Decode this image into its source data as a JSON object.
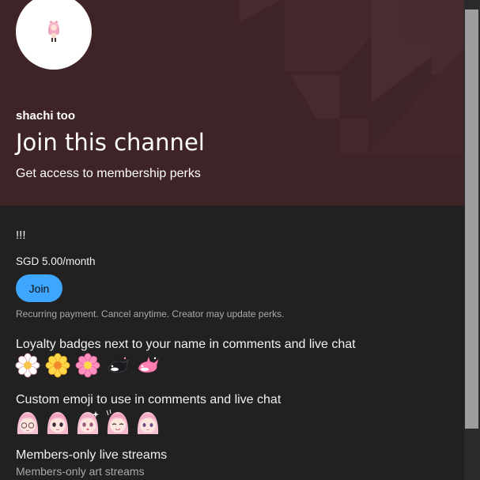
{
  "header": {
    "channel_name": "shachi too",
    "title": "Join this channel",
    "subtitle": "Get access to membership perks",
    "background_color": "#3e2327",
    "avatar_icon": "pink-hair-character-avatar"
  },
  "tier": {
    "name": "!!!",
    "price": "SGD 5.00/month",
    "join_label": "Join",
    "join_color": "#3ea6ff",
    "recurring_note": "Recurring payment. Cancel anytime. Creator may update perks."
  },
  "perks": {
    "badges_title": "Loyalty badges next to your name in comments and live chat",
    "badges": [
      "white-flower-badge",
      "yellow-flower-badge",
      "pink-flower-badge",
      "orca-badge",
      "pink-orca-badge"
    ],
    "emoji_title": "Custom emoji to use in comments and live chat",
    "emoji": [
      "pink-girl-glasses-emoji",
      "pink-girl-eyes-emoji",
      "pink-girl-sparkle-emoji",
      "pink-girl-smile-emoji",
      "pink-girl-calm-emoji"
    ],
    "livestreams_title": "Members-only live streams",
    "livestreams_sub": "Members-only art streams"
  }
}
